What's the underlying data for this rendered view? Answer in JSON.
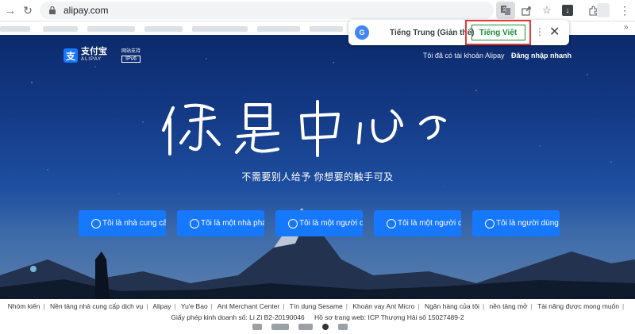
{
  "browser": {
    "url": "alipay.com"
  },
  "translate_popup": {
    "source_language": "Tiếng Trung (Giản thể)",
    "target_language": "Tiếng Việt"
  },
  "header": {
    "logo_text": "支付宝",
    "logo_sub": "ALIPAY",
    "badge_top": "网站支持",
    "badge_bottom": "IPv6",
    "account_prompt": "Tôi đã có tài khoản Alipay",
    "quick_login": "Đăng nhập nhanh"
  },
  "hero": {
    "tagline": "不需要别人给予 你想要的触手可及",
    "roles": [
      {
        "label": "Tôi là nhà cung cấp",
        "icon": "supplier-icon"
      },
      {
        "label": "Tôi là một nhà phát triển",
        "icon": "developer-icon"
      },
      {
        "label": "Tôi là một người dùng",
        "icon": "user-icon"
      },
      {
        "label": "Tôi là một người dùng",
        "icon": "merchant-icon"
      },
      {
        "label": "Tôi là người dùng cá nhân",
        "icon": "personal-icon"
      }
    ]
  },
  "footer": {
    "links": [
      "Nhóm kiến",
      "Nền tảng nhà cung cấp dịch vụ",
      "Alipay",
      "Yu'e Bao",
      "Ant Merchant Center",
      "Tín dụng Sesame",
      "Khoản vay Ant Micro",
      "Ngân hàng của tôi",
      "nền tảng mở",
      "Tài năng được mong muốn"
    ],
    "license": "Giấy phép kinh doanh số: Li Zi B2-20190046",
    "icp": "Hồ sơ trang web: ICP Thượng Hải số 15027489-2"
  },
  "colors": {
    "accent": "#1677ff",
    "highlight_border": "#e53935",
    "translate_green": "#1a8f3a"
  }
}
